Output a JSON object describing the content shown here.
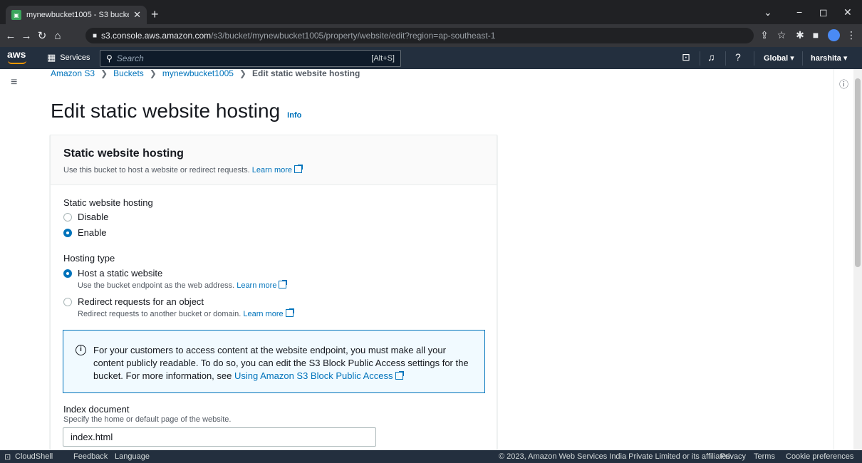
{
  "browser": {
    "tab_title": "mynewbucket1005 - S3 bucket",
    "url_host": "s3.console.aws.amazon.com",
    "url_path": "/s3/bucket/mynewbucket1005/property/website/edit?region=ap-southeast-1"
  },
  "header": {
    "logo": "aws",
    "services": "Services",
    "search_placeholder": "Search",
    "search_shortcut": "[Alt+S]",
    "region": "Global ▾",
    "user": "harshita ▾"
  },
  "breadcrumb": [
    "Amazon S3",
    "Buckets",
    "mynewbucket1005",
    "Edit static website hosting"
  ],
  "page": {
    "title": "Edit static website hosting",
    "info_link": "Info"
  },
  "panel": {
    "title": "Static website hosting",
    "description": "Use this bucket to host a website or redirect requests.",
    "learn_more": "Learn more",
    "hosting_label": "Static website hosting",
    "hosting_options": [
      {
        "label": "Disable",
        "selected": false
      },
      {
        "label": "Enable",
        "selected": true
      }
    ],
    "type_label": "Hosting type",
    "type_options": [
      {
        "label": "Host a static website",
        "desc": "Use the bucket endpoint as the web address.",
        "selected": true
      },
      {
        "label": "Redirect requests for an object",
        "desc": "Redirect requests to another bucket or domain.",
        "selected": false
      }
    ],
    "alert_text": "For your customers to access content at the website endpoint, you must make all your content publicly readable. To do so, you can edit the S3 Block Public Access settings for the bucket. For more information, see",
    "alert_link": "Using Amazon S3 Block Public Access",
    "index_label": "Index document",
    "index_desc": "Specify the home or default page of the website.",
    "index_value": "index.html"
  },
  "footer": {
    "cloudshell": "CloudShell",
    "feedback": "Feedback",
    "language": "Language",
    "copyright": "© 2023, Amazon Web Services India Private Limited or its affiliates.",
    "privacy": "Privacy",
    "terms": "Terms",
    "cookies": "Cookie preferences"
  },
  "colors": {
    "accent": "#0073bb",
    "aws_dark": "#232f3e",
    "aws_orange": "#ff9900"
  }
}
